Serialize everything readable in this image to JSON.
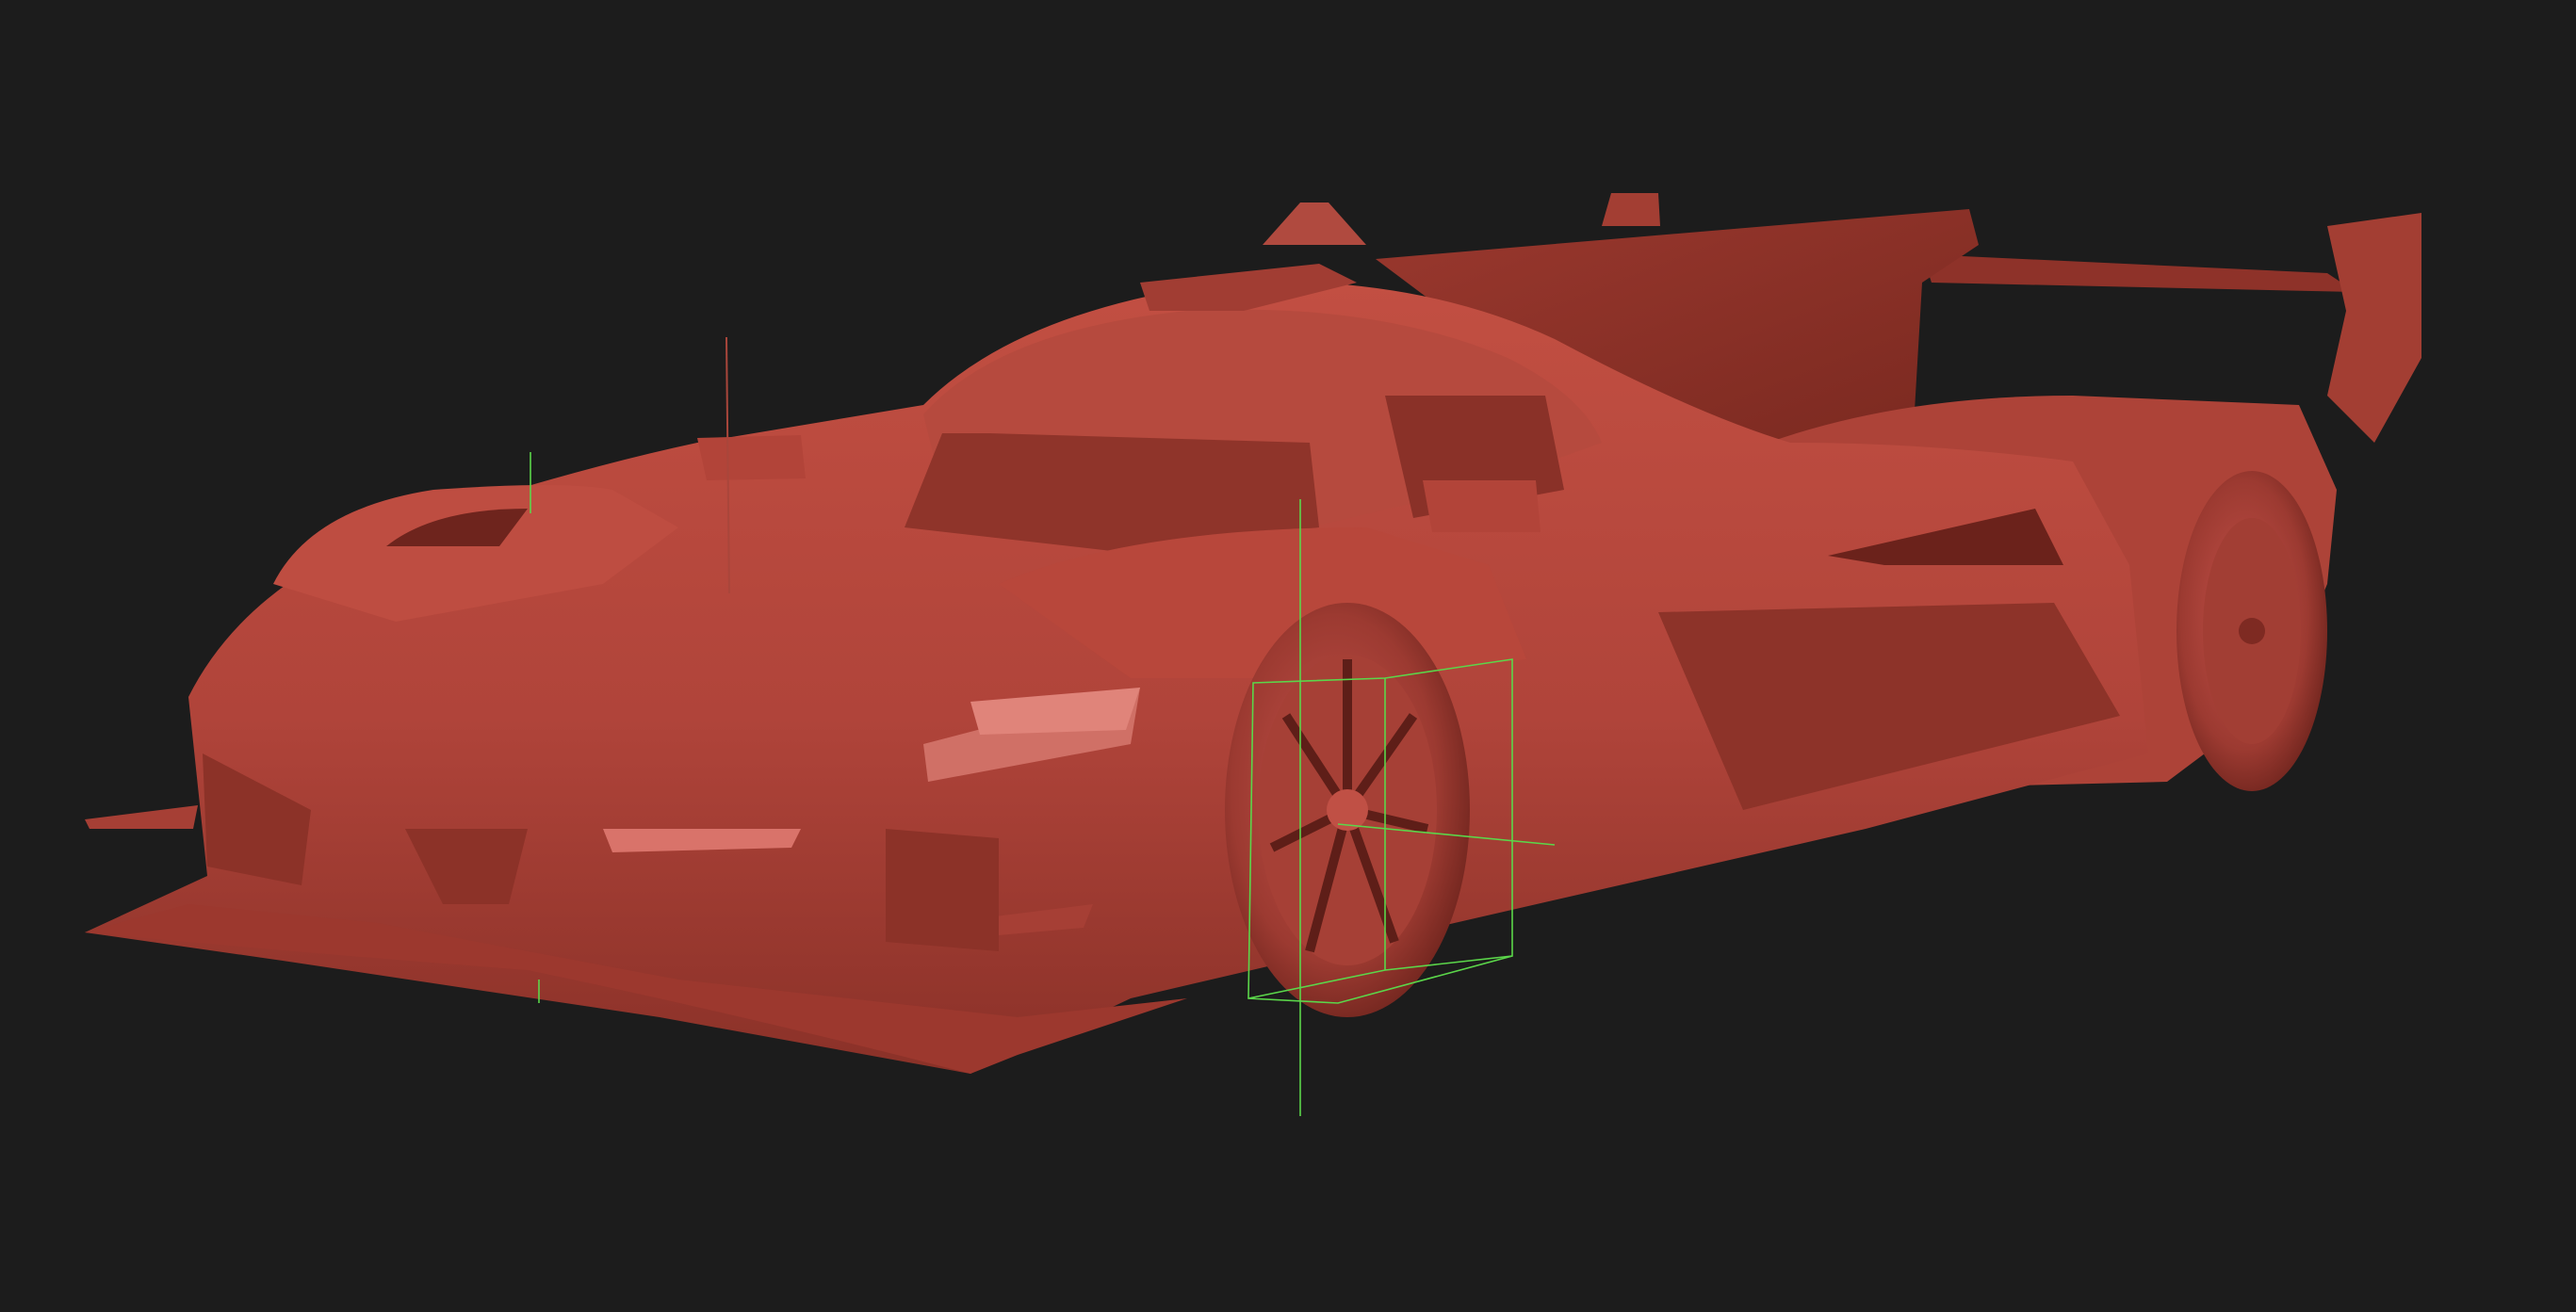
{
  "viewport": {
    "background": "#1c1c1c",
    "model": "le-mans-prototype-race-car",
    "material_color": "#b8473b",
    "material_shadow": "#7e2a22",
    "material_highlight": "#cf5a4b",
    "gizmo_color": "#5bd64a",
    "selected_object": "front-right-wheel"
  }
}
